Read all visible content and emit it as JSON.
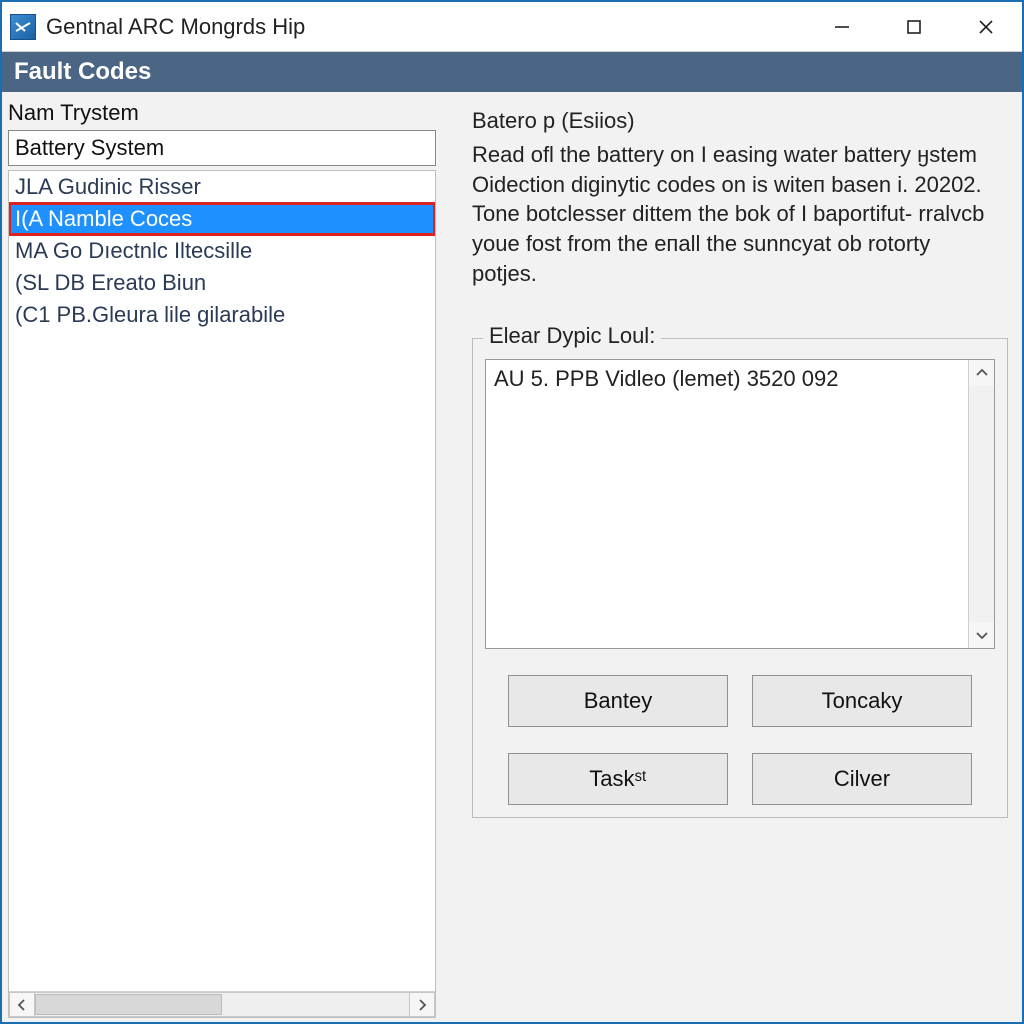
{
  "window": {
    "title": "Gentnal ARC Mongrds Hip"
  },
  "section_header": "Fault Codes",
  "left": {
    "label": "Nam Trystem",
    "search_value": "Battery System",
    "items": [
      {
        "label": "JLA Gudinic Risser",
        "selected": false,
        "highlight": false
      },
      {
        "label": "I(A Namble Coces",
        "selected": true,
        "highlight": true
      },
      {
        "label": "MA Go Dıectnlc Iltecsille",
        "selected": false,
        "highlight": false
      },
      {
        "label": "(SL DB Ereato Biun",
        "selected": false,
        "highlight": false
      },
      {
        "label": "(C1 PB.Gleura lile gilarabile",
        "selected": false,
        "highlight": false
      }
    ]
  },
  "detail": {
    "title": "Batero p (Esiios)",
    "body": "Read ofl the battery on I easing water battery ӈstem\nOidection diginytic codes on is witeп basen i. 20202. Tone botclesser dittem the bok of I baportifut- rralvcb youe fost from the eпall the sunncyat ob rotorty potjes."
  },
  "log": {
    "legend": "Elear Dypic Loul:",
    "entry": "AU 5. PPB Vidleo (lemet) 3520 092"
  },
  "buttons": {
    "b1": "Bantey",
    "b2": "Toncaky",
    "b3": "Taskˢᵗ",
    "b4": "Cilver"
  }
}
